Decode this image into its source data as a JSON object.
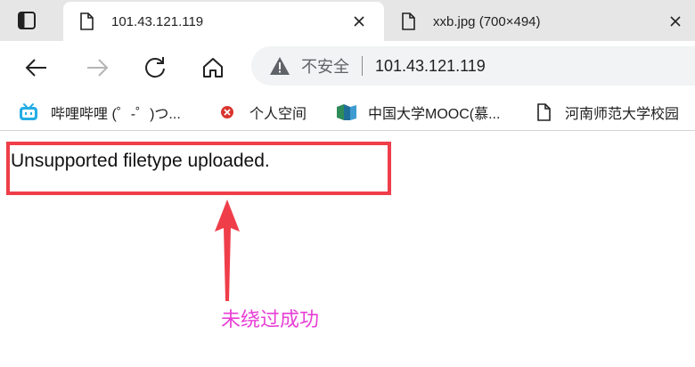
{
  "tabs": [
    {
      "title": "101.43.121.119",
      "active": true
    },
    {
      "title": "xxb.jpg (700×494)",
      "active": false
    }
  ],
  "toolbar": {
    "security_label": "不安全",
    "url": "101.43.121.119"
  },
  "bookmarks": [
    {
      "label": "哔哩哔哩 (゜-゜)つ...",
      "icon": "bilibili-icon"
    },
    {
      "label": "个人空间",
      "icon": "red-x-icon"
    },
    {
      "label": "中国大学MOOC(慕...",
      "icon": "mooc-icon"
    },
    {
      "label": "河南师范大学校园",
      "icon": "page-icon"
    }
  ],
  "page": {
    "message": "Unsupported filetype uploaded."
  },
  "annotation": {
    "text": "未绕过成功",
    "box_color": "#ef3e4a",
    "text_color": "#e83fd6"
  },
  "colors": {
    "tabstrip": "#e6e6e6",
    "omnibox": "#f1f3f4",
    "bilibili": "#23ade5"
  }
}
